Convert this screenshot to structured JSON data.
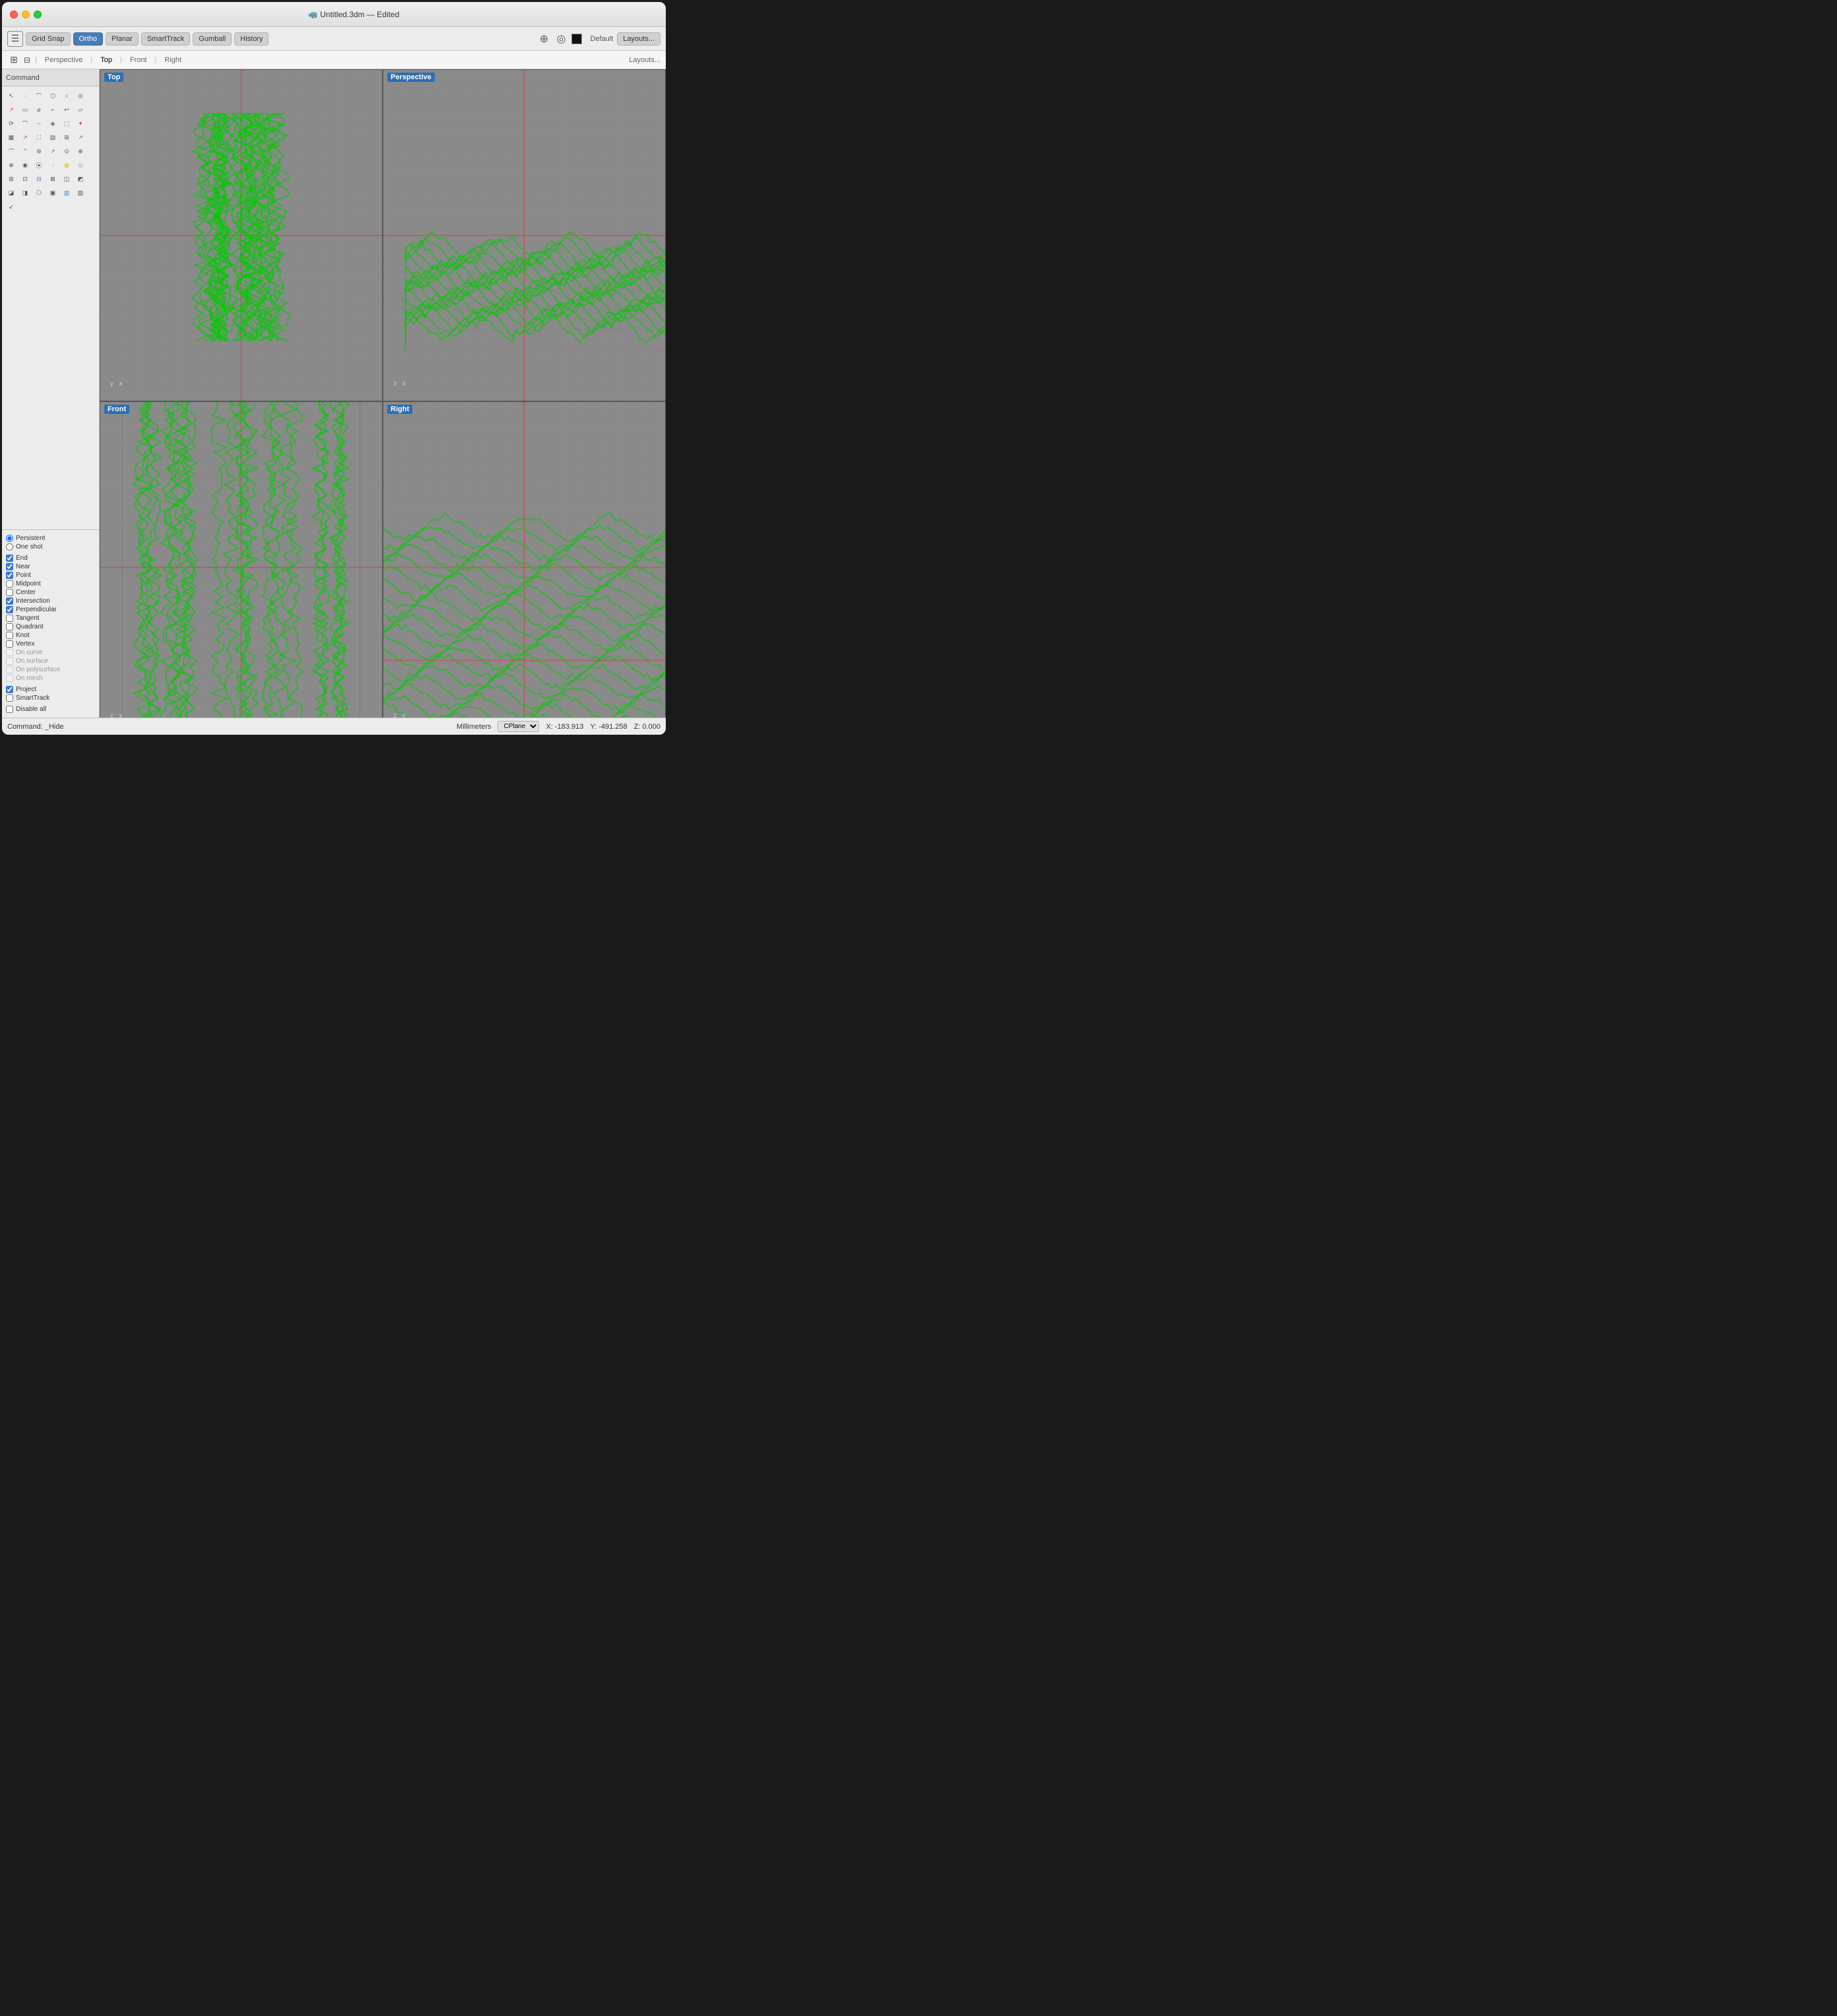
{
  "window": {
    "title": "🦏 Untitled.3dm — Edited"
  },
  "toolbar": {
    "grid_snap": "Grid Snap",
    "ortho": "Ortho",
    "planar": "Planar",
    "smart_track": "SmartTrack",
    "gumball": "Gumball",
    "history": "History",
    "default_label": "Default",
    "layouts_label": "Layouts..."
  },
  "tabs": [
    {
      "label": "Perspective",
      "active": false
    },
    {
      "label": "Top",
      "active": true
    },
    {
      "label": "Front",
      "active": false
    },
    {
      "label": "Right",
      "active": false
    }
  ],
  "command_bar": {
    "label": "Command"
  },
  "viewports": [
    {
      "id": "top",
      "label": "Top",
      "axis": "y  x"
    },
    {
      "id": "perspective",
      "label": "Perspective",
      "axis": "z  x"
    },
    {
      "id": "front",
      "label": "Front",
      "axis": "z  x"
    },
    {
      "id": "right",
      "label": "Right",
      "axis": "z  y"
    }
  ],
  "snap_panel": {
    "persistent": "Persistent",
    "one_shot": "One shot",
    "end": "End",
    "near": "Near",
    "point": "Point",
    "midpoint": "Midpoint",
    "center": "Center",
    "intersection": "Intersection",
    "perpendicular": "Perpendicular",
    "tangent": "Tangent",
    "quadrant": "Quadrant",
    "knot": "Knot",
    "vertex": "Vertex",
    "on_curve": "On curve",
    "on_surface": "On surface",
    "on_polysurface": "On polysurface",
    "on_mesh": "On mesh",
    "project": "Project",
    "smart_track": "SmartTrack",
    "disable_all": "Disable all"
  },
  "status_bar": {
    "command": "Command: _Hide",
    "units": "Millimeters",
    "cplane": "CPlane",
    "x": "X: -183.913",
    "y": "Y: -491.258",
    "z": "Z: 0.000"
  },
  "tool_icons": [
    "↖",
    "·",
    "⌒",
    "⬡",
    "○",
    "◎",
    "↗",
    "▭",
    "⌀",
    "⌐",
    "↩",
    "▱",
    "⟳",
    "⌒",
    "⌣",
    "◈",
    "⬚",
    "✦",
    "▦",
    "↗",
    "⛶",
    "▤",
    "⊞",
    "↗",
    "⌒",
    "⌃",
    "⊛",
    "↗",
    "⊙",
    "⊕",
    "⊗",
    "◉",
    "⦿",
    "◌",
    "◍",
    "◎",
    "⊞",
    "⊡",
    "⊟",
    "⊠",
    "◫",
    "◩",
    "◪",
    "◨",
    "⎔",
    "▣",
    "▥",
    "▧",
    "↙"
  ]
}
